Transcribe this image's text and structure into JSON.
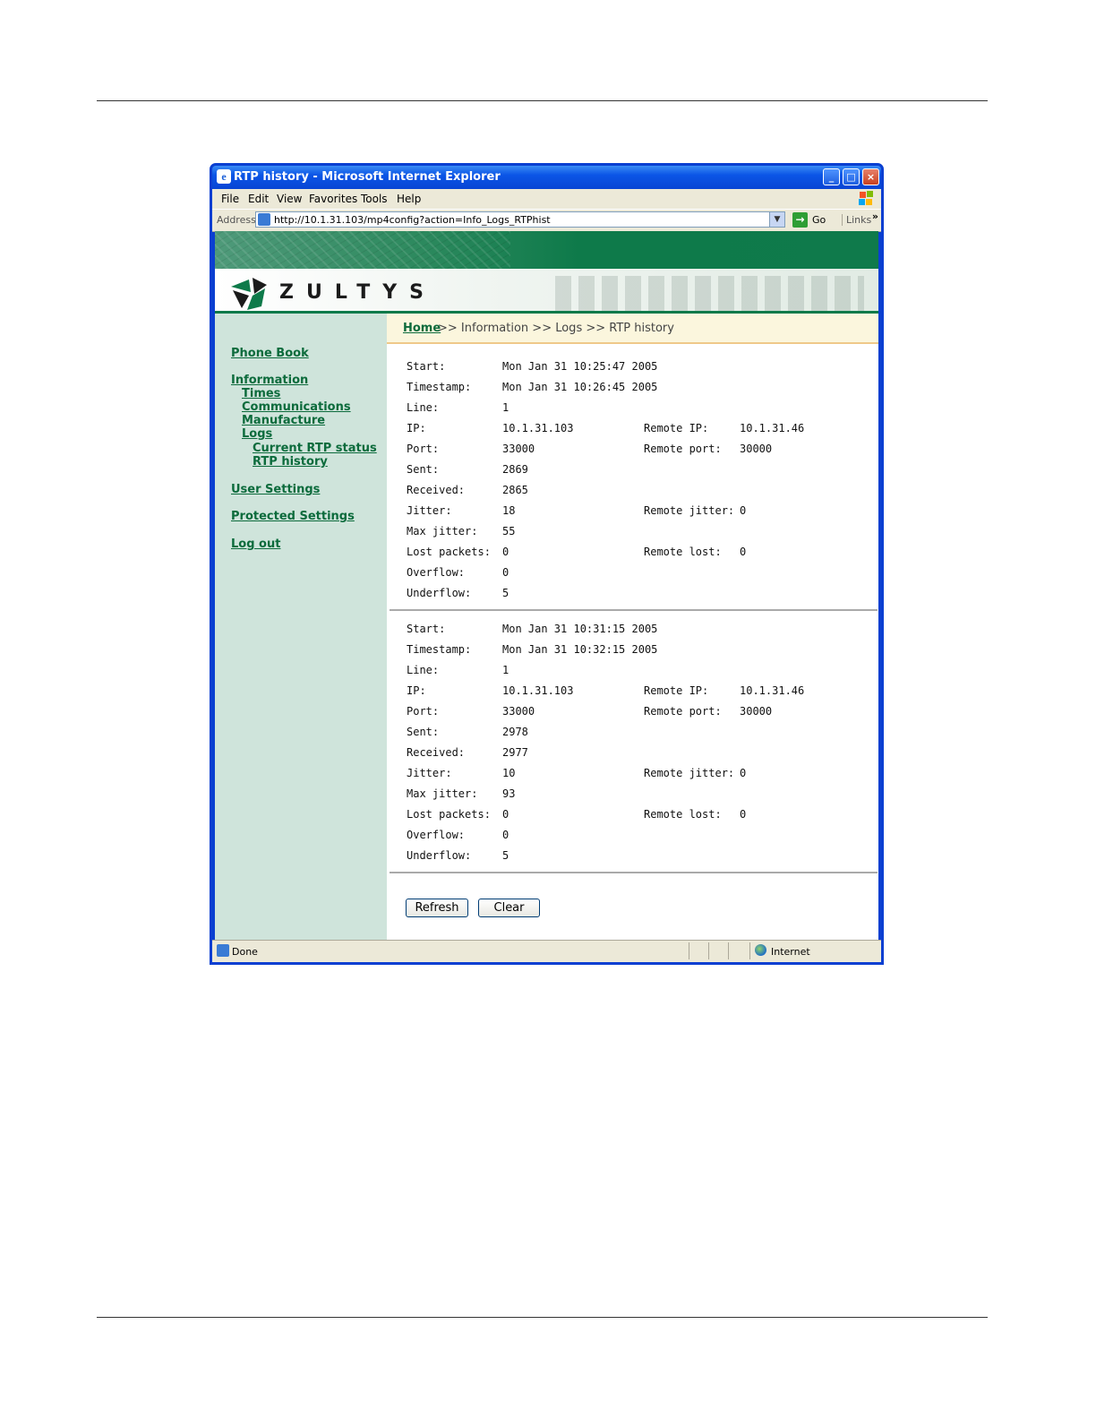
{
  "window": {
    "title": "RTP history - Microsoft Internet Explorer",
    "minimize": "_",
    "maximize": "□",
    "close": "×"
  },
  "menu": [
    "File",
    "Edit",
    "View",
    "Favorites",
    "Tools",
    "Help"
  ],
  "address": {
    "label": "Address",
    "url": "http://10.1.31.103/mp4config?action=Info_Logs_RTPhist",
    "go": "Go",
    "links": "Links",
    "more": "»"
  },
  "brand": {
    "name": "ZULTYS"
  },
  "sidebar": {
    "phone_book": "Phone Book",
    "information": "Information",
    "times": "Times",
    "communications": "Communications",
    "manufacture": "Manufacture",
    "logs": "Logs",
    "current_rtp": "Current RTP status",
    "rtp_history": "RTP history",
    "user_settings": "User Settings",
    "protected_settings": "Protected Settings",
    "logout": "Log out"
  },
  "breadcrumb": {
    "home": "Home",
    "rest": ">> Information >> Logs >> RTP history"
  },
  "labels": {
    "start": "Start:",
    "timestamp": "Timestamp:",
    "line": "Line:",
    "ip": "IP:",
    "remote_ip": "Remote IP:",
    "port": "Port:",
    "remote_port": "Remote port:",
    "sent": "Sent:",
    "received": "Received:",
    "jitter": "Jitter:",
    "remote_jitter": "Remote jitter:",
    "max_jitter": "Max jitter:",
    "lost_packets": "Lost packets:",
    "remote_lost": "Remote lost:",
    "overflow": "Overflow:",
    "underflow": "Underflow:"
  },
  "entries": [
    {
      "start": "Mon Jan 31 10:25:47 2005",
      "timestamp": "Mon Jan 31 10:26:45 2005",
      "line": "1",
      "ip": "10.1.31.103",
      "remote_ip": "10.1.31.46",
      "port": "33000",
      "remote_port": "30000",
      "sent": "2869",
      "received": "2865",
      "jitter": "18",
      "remote_jitter": "0",
      "max_jitter": "55",
      "lost_packets": "0",
      "remote_lost": "0",
      "overflow": "0",
      "underflow": "5"
    },
    {
      "start": "Mon Jan 31 10:31:15 2005",
      "timestamp": "Mon Jan 31 10:32:15 2005",
      "line": "1",
      "ip": "10.1.31.103",
      "remote_ip": "10.1.31.46",
      "port": "33000",
      "remote_port": "30000",
      "sent": "2978",
      "received": "2977",
      "jitter": "10",
      "remote_jitter": "0",
      "max_jitter": "93",
      "lost_packets": "0",
      "remote_lost": "0",
      "overflow": "0",
      "underflow": "5"
    }
  ],
  "buttons": {
    "refresh": "Refresh",
    "clear": "Clear"
  },
  "status": {
    "text": "Done",
    "zone": "Internet"
  },
  "colors": {
    "accent_green": "#0e7a4a",
    "sidebar_bg": "#cfe4db",
    "link": "#0c6b3c",
    "titlebar": "#0b55e6"
  }
}
